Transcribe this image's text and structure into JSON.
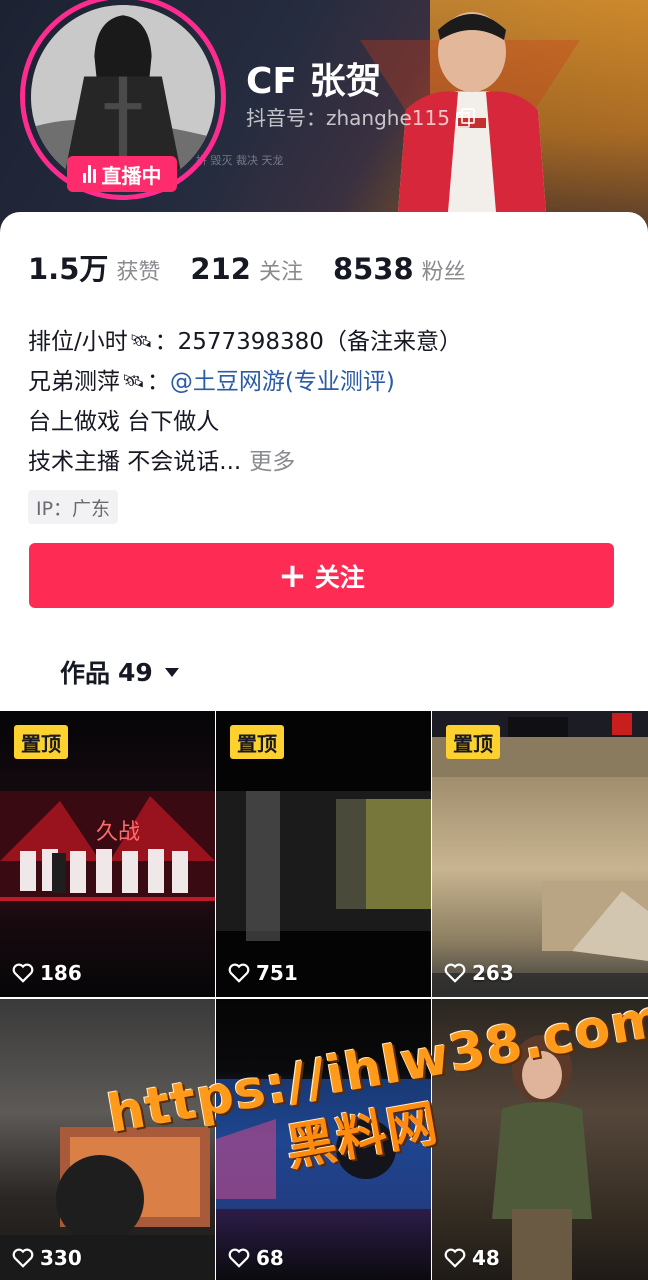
{
  "profile": {
    "nickname": "CF 张贺",
    "douyin_id": "抖音号：zhanghe115",
    "live_badge": "直播中",
    "header_slogan": "拼 毁灭 裁决 天龙"
  },
  "stats": [
    {
      "value": "1.5万",
      "label": "获赞"
    },
    {
      "value": "212",
      "label": "关注"
    },
    {
      "value": "8538",
      "label": "粉丝"
    }
  ],
  "bio": {
    "line1_prefix": "排位/小时",
    "line1_suffix": "：2577398380（备注来意）",
    "line2_prefix": "兄弟测萍",
    "line2_colon": "：",
    "line2_link": "@土豆网游(专业测评)",
    "line3": "台上做戏 台下做人",
    "line4": "技术主播 不会说话...",
    "more": "更多"
  },
  "ip_tag": "IP：广东",
  "follow_button": {
    "label": "关注"
  },
  "works_tab": {
    "label": "作品",
    "count": "49"
  },
  "videos": [
    {
      "pinned": "置顶",
      "likes": "186"
    },
    {
      "pinned": "置顶",
      "likes": "751"
    },
    {
      "pinned": "置顶",
      "likes": "263"
    },
    {
      "likes": "330"
    },
    {
      "likes": "68"
    },
    {
      "likes": "48"
    }
  ],
  "watermark": {
    "line1": "https://ihlw38.com",
    "line2": "黑料网"
  },
  "colors": {
    "follow_button": "#fe2c55",
    "live_ring": "#fe2c8f",
    "pin_badge": "#ffd12e",
    "link": "#2a5aa8"
  },
  "icons": [
    "live-bars-icon",
    "copy-icon",
    "satellite-icon",
    "plus-icon",
    "caret-down-icon",
    "heart-icon"
  ]
}
